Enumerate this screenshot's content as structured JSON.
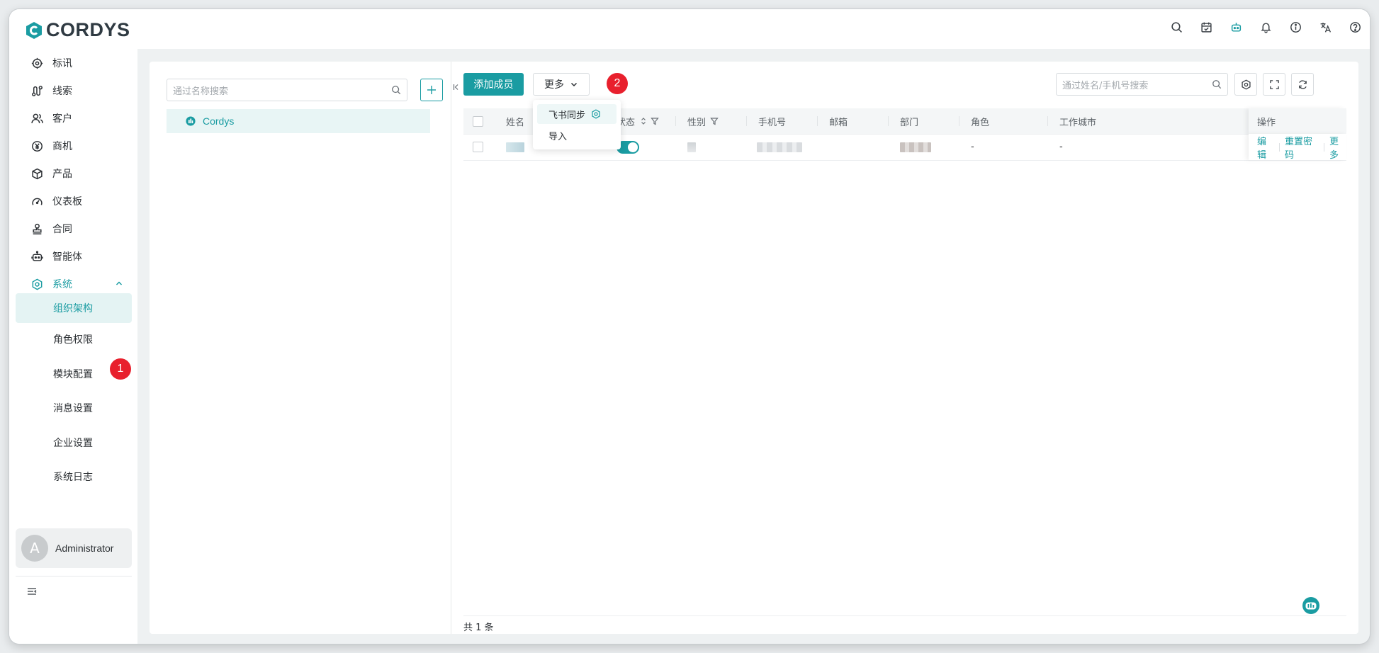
{
  "brand": {
    "name": "CORDYS",
    "accent": "#1a9ca2"
  },
  "topbar": {
    "icons": [
      "search-icon",
      "calendar-icon",
      "robot-icon",
      "bell-icon",
      "info-icon",
      "translate-icon",
      "help-icon"
    ]
  },
  "sidebar": {
    "items": [
      {
        "label": "标讯",
        "icon": "target-icon"
      },
      {
        "label": "线索",
        "icon": "route-icon"
      },
      {
        "label": "客户",
        "icon": "users-icon"
      },
      {
        "label": "商机",
        "icon": "yen-circle-icon"
      },
      {
        "label": "产品",
        "icon": "box-icon"
      },
      {
        "label": "仪表板",
        "icon": "gauge-icon"
      },
      {
        "label": "合同",
        "icon": "stamp-icon"
      },
      {
        "label": "智能体",
        "icon": "robot-icon"
      },
      {
        "label": "系统",
        "icon": "settings-icon"
      }
    ],
    "system_children": [
      {
        "label": "组织架构",
        "active": true
      },
      {
        "label": "角色权限"
      },
      {
        "label": "模块配置"
      },
      {
        "label": "消息设置"
      },
      {
        "label": "企业设置"
      },
      {
        "label": "系统日志"
      }
    ],
    "user": {
      "initial": "A",
      "name": "Administrator"
    }
  },
  "badges": {
    "one": "1",
    "two": "2"
  },
  "tree": {
    "search_placeholder": "通过名称搜索",
    "root": "Cordys"
  },
  "toolbar": {
    "add_member": "添加成员",
    "more": "更多",
    "more_menu": [
      "飞书同步",
      "导入"
    ],
    "search_placeholder": "通过姓名/手机号搜索"
  },
  "table": {
    "columns": [
      "姓名",
      "状态",
      "性别",
      "手机号",
      "邮箱",
      "部门",
      "角色",
      "工作城市",
      "操作"
    ],
    "rows": [
      {
        "status_on": true,
        "role": "-",
        "city": "-",
        "actions": [
          "编辑",
          "重置密码",
          "更多"
        ]
      }
    ],
    "total": "共 1 条"
  }
}
